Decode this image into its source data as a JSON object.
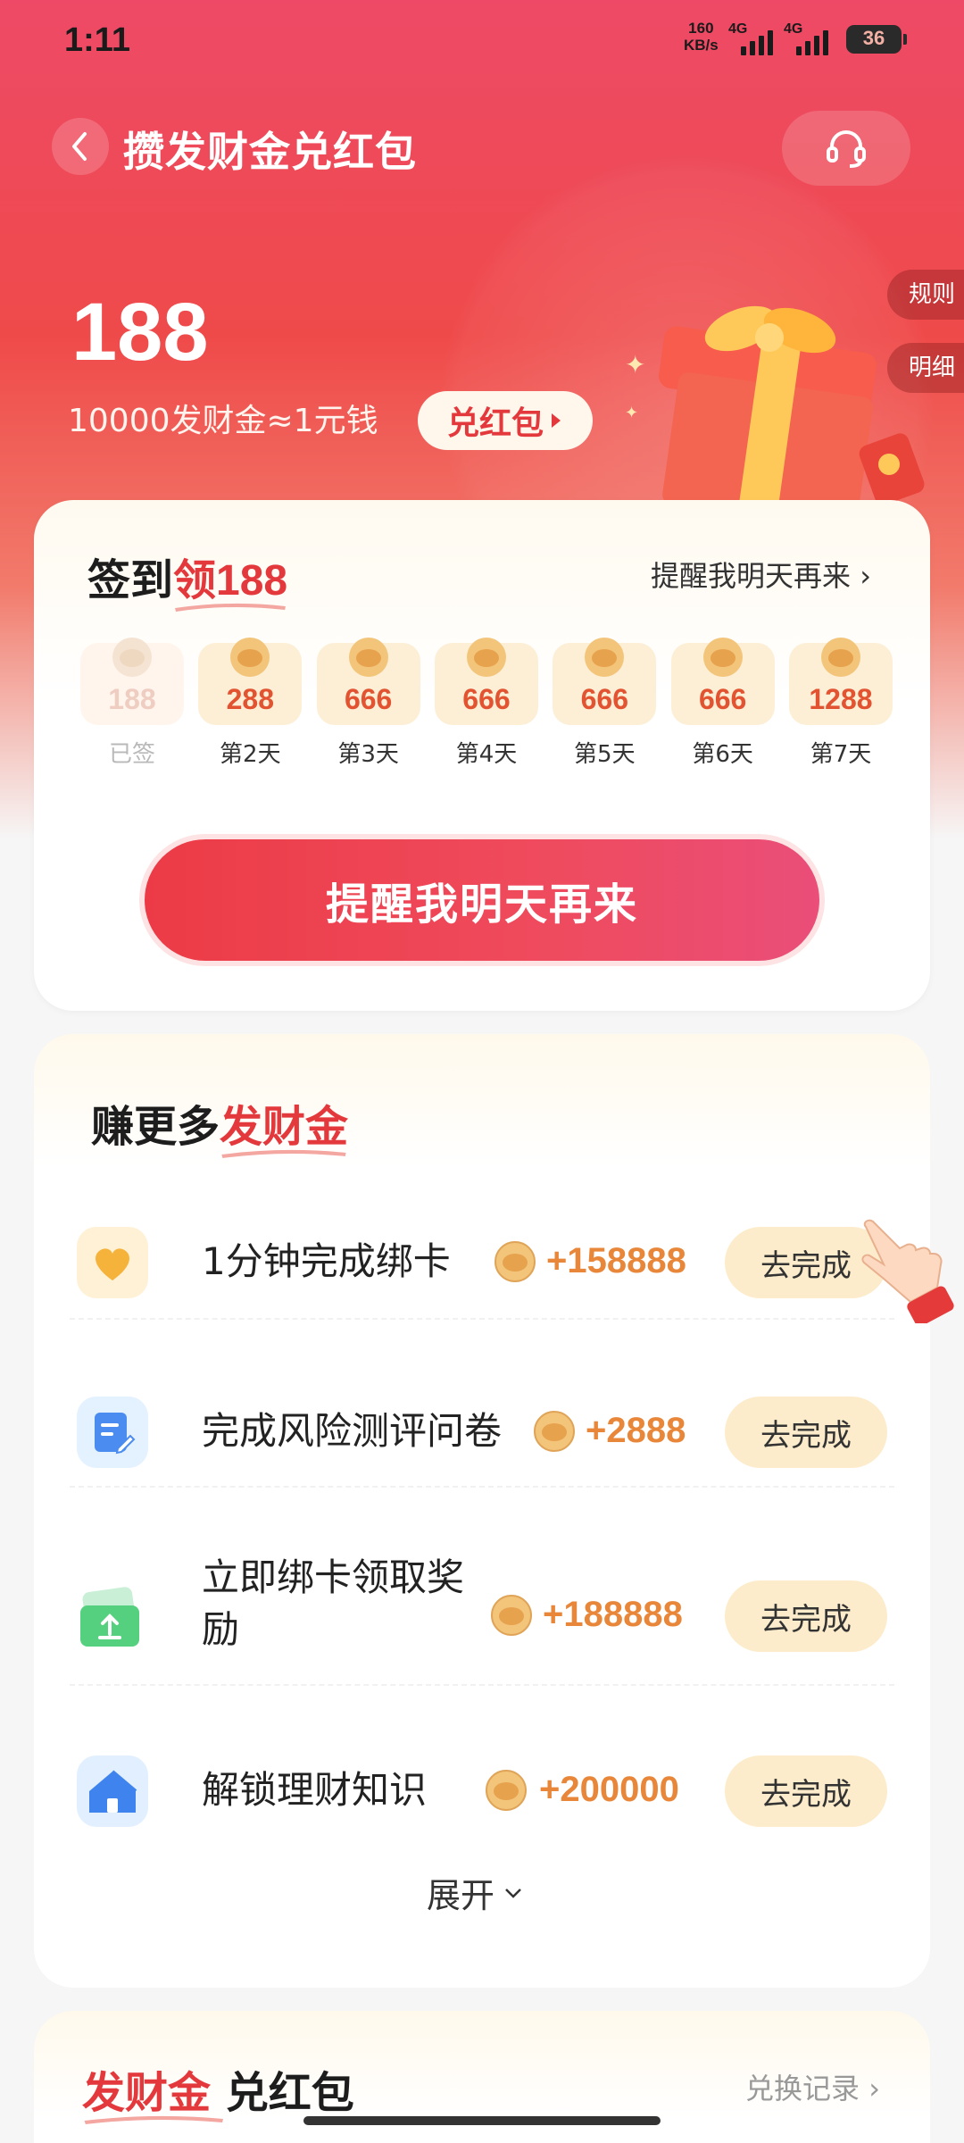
{
  "status_bar": {
    "time": "1:11",
    "net_speed_value": "160",
    "net_speed_unit": "KB/s",
    "sim1": "4G",
    "sim2": "4G",
    "battery": "36"
  },
  "header": {
    "title": "攒发财金兑红包",
    "side_tabs": [
      "规则",
      "明细"
    ]
  },
  "hero": {
    "balance": "188",
    "rate_text": "10000发财金≈1元钱",
    "redeem_label": "兑红包"
  },
  "checkin": {
    "title_prefix": "签到",
    "title_accent": "领",
    "title_accent_num": "188",
    "remind_link": "提醒我明天再来",
    "days": [
      {
        "value": "188",
        "label": "已签",
        "done": true
      },
      {
        "value": "288",
        "label": "第2天",
        "done": false
      },
      {
        "value": "666",
        "label": "第3天",
        "done": false
      },
      {
        "value": "666",
        "label": "第4天",
        "done": false
      },
      {
        "value": "666",
        "label": "第5天",
        "done": false
      },
      {
        "value": "666",
        "label": "第6天",
        "done": false
      },
      {
        "value": "1288",
        "label": "第7天",
        "done": false
      }
    ],
    "button_label": "提醒我明天再来"
  },
  "tasks": {
    "title_prefix": "赚更多",
    "title_accent": "发财金",
    "items": [
      {
        "name": "1分钟完成绑卡",
        "reward": "+158888",
        "action": "去完成",
        "icon": "heart-icon"
      },
      {
        "name": "完成风险测评问卷",
        "reward": "+2888",
        "action": "去完成",
        "icon": "questionnaire-icon"
      },
      {
        "name": "立即绑卡领取奖\n励",
        "reward": "+188888",
        "action": "去完成",
        "icon": "card-upload-icon"
      },
      {
        "name": "解锁理财知识",
        "reward": "+200000",
        "action": "去完成",
        "icon": "house-icon"
      }
    ],
    "expand_label": "展开"
  },
  "exchange": {
    "title_accent": "发财金",
    "title_suffix": "兑红包",
    "record_link": "兑换记录"
  },
  "colors": {
    "brand_red": "#e4393c",
    "reward_orange": "#e8873a",
    "go_button_bg": "#fdeccb"
  }
}
